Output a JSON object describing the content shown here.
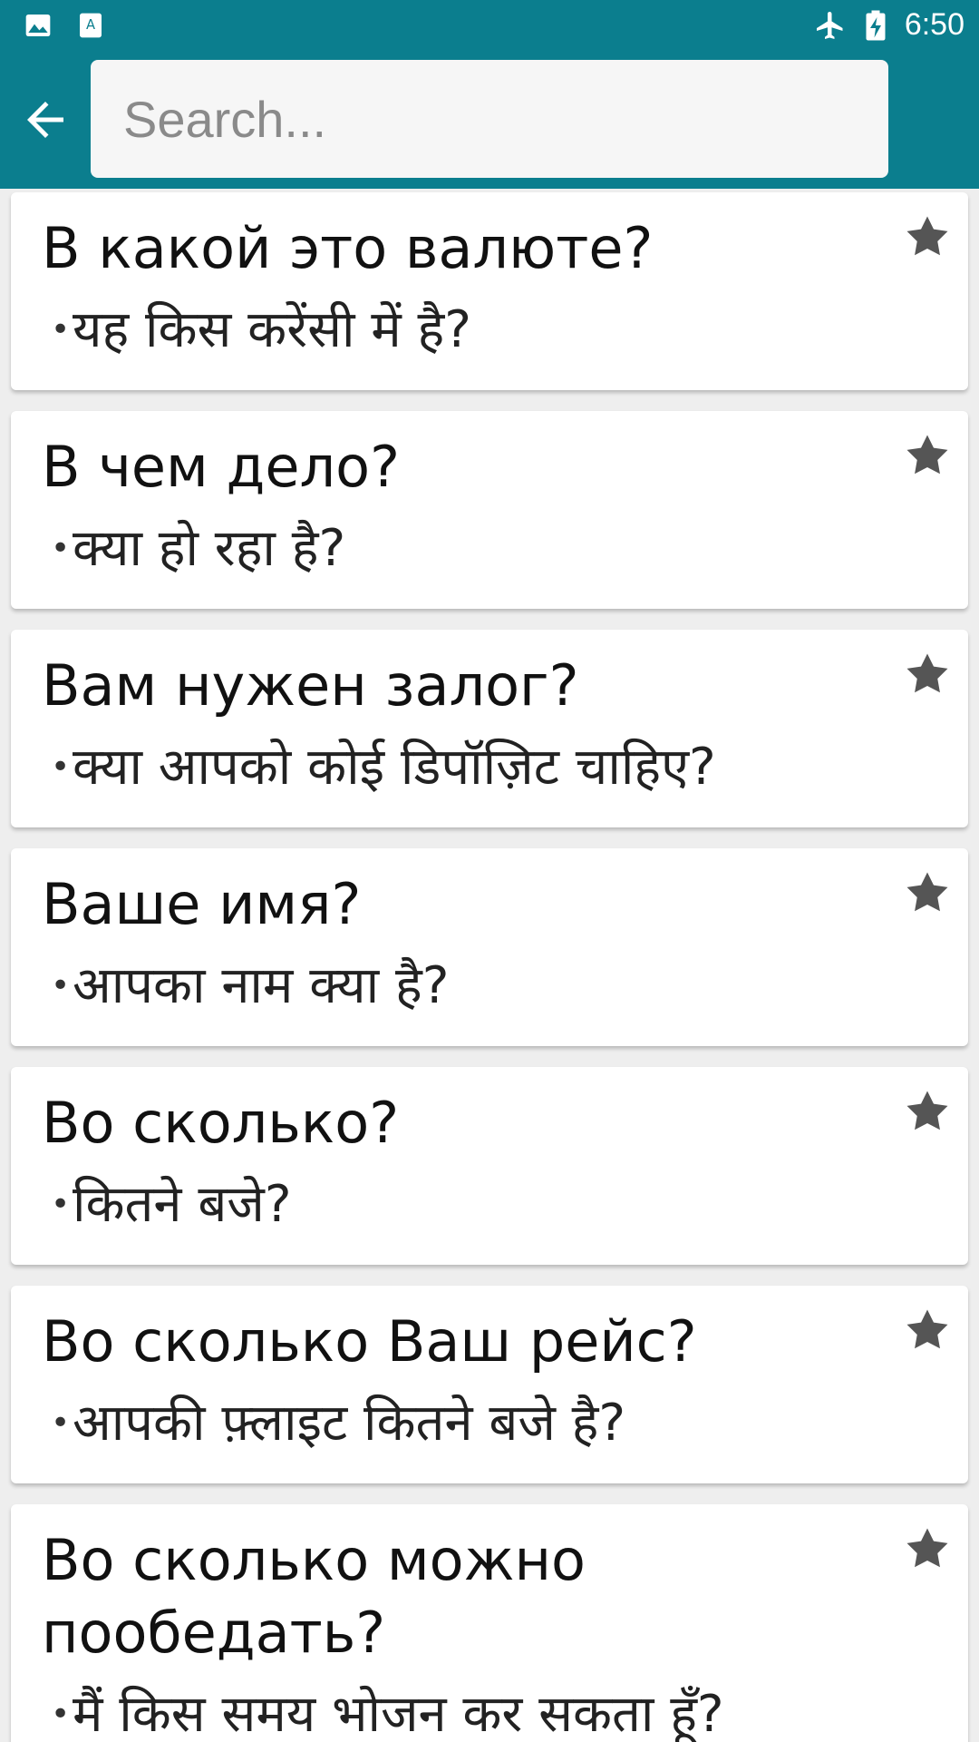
{
  "status_bar": {
    "left_icons": [
      "image-icon",
      "app-icon"
    ],
    "right_icons": [
      "airplane-icon",
      "battery-charging-icon"
    ],
    "time": "6:50"
  },
  "appbar": {
    "back_icon": "arrow-left-icon",
    "search": {
      "value": "",
      "placeholder": "Search..."
    }
  },
  "phrases": [
    {
      "ru": "В какой это валюте?",
      "hi": "यह किस करेंसी में है?"
    },
    {
      "ru": "В чем дело?",
      "hi": "क्या हो रहा है?"
    },
    {
      "ru": "Вам нужен залог?",
      "hi": "क्या आपको कोई डिपॉज़िट चाहिए?"
    },
    {
      "ru": "Ваше имя?",
      "hi": "आपका नाम क्या है?"
    },
    {
      "ru": "Во сколько?",
      "hi": "कितने बजे?"
    },
    {
      "ru": "Во сколько Ваш рейс?",
      "hi": "आपकी फ़्लाइट कितने बजे है?"
    },
    {
      "ru": "Во сколько можно пообедать?",
      "hi": "मैं किस समय भोजन कर सकता हूँ?"
    }
  ],
  "colors": {
    "accent": "#0b7e8e",
    "star": "#555555"
  }
}
